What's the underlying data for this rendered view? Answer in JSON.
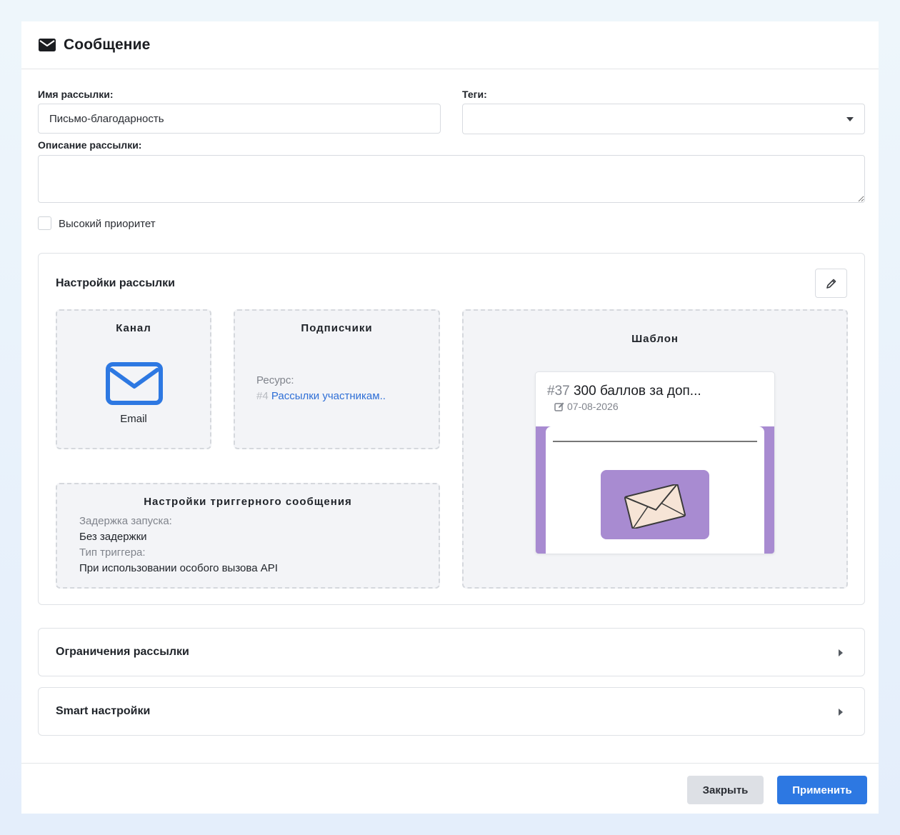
{
  "header": {
    "title": "Сообщение",
    "icon": "envelope-icon"
  },
  "form": {
    "name_label": "Имя рассылки:",
    "name_value": "Письмо-благодарность",
    "tags_label": "Теги:",
    "tags_value": "",
    "description_label": "Описание рассылки:",
    "description_value": "",
    "priority_label": "Высокий приоритет",
    "priority_checked": false
  },
  "settings": {
    "title": "Настройки рассылки",
    "edit_icon": "pencil-icon",
    "channel": {
      "title": "Канал",
      "icon": "envelope-icon",
      "name": "Email",
      "icon_color": "#2d78e2"
    },
    "subscribers": {
      "title": "Подписчики",
      "resource_label": "Ресурс:",
      "resource_id": "#4",
      "resource_name": "Рассылки участникам.."
    },
    "template": {
      "title": "Шаблон",
      "id": "#37",
      "name": "300 баллов за доп...",
      "date": "07-08-2026",
      "date_icon": "edit-icon",
      "preview_color": "#a88bd1"
    },
    "trigger": {
      "title": "Настройки триггерного сообщения",
      "delay_label": "Задержка запуска:",
      "delay_value": "Без задержки",
      "type_label": "Тип триггера:",
      "type_value": "При использовании особого вызова API"
    }
  },
  "sections": {
    "limits": "Ограничения рассылки",
    "smart": "Smart настройки"
  },
  "footer": {
    "close_label": "Закрыть",
    "apply_label": "Применить"
  }
}
